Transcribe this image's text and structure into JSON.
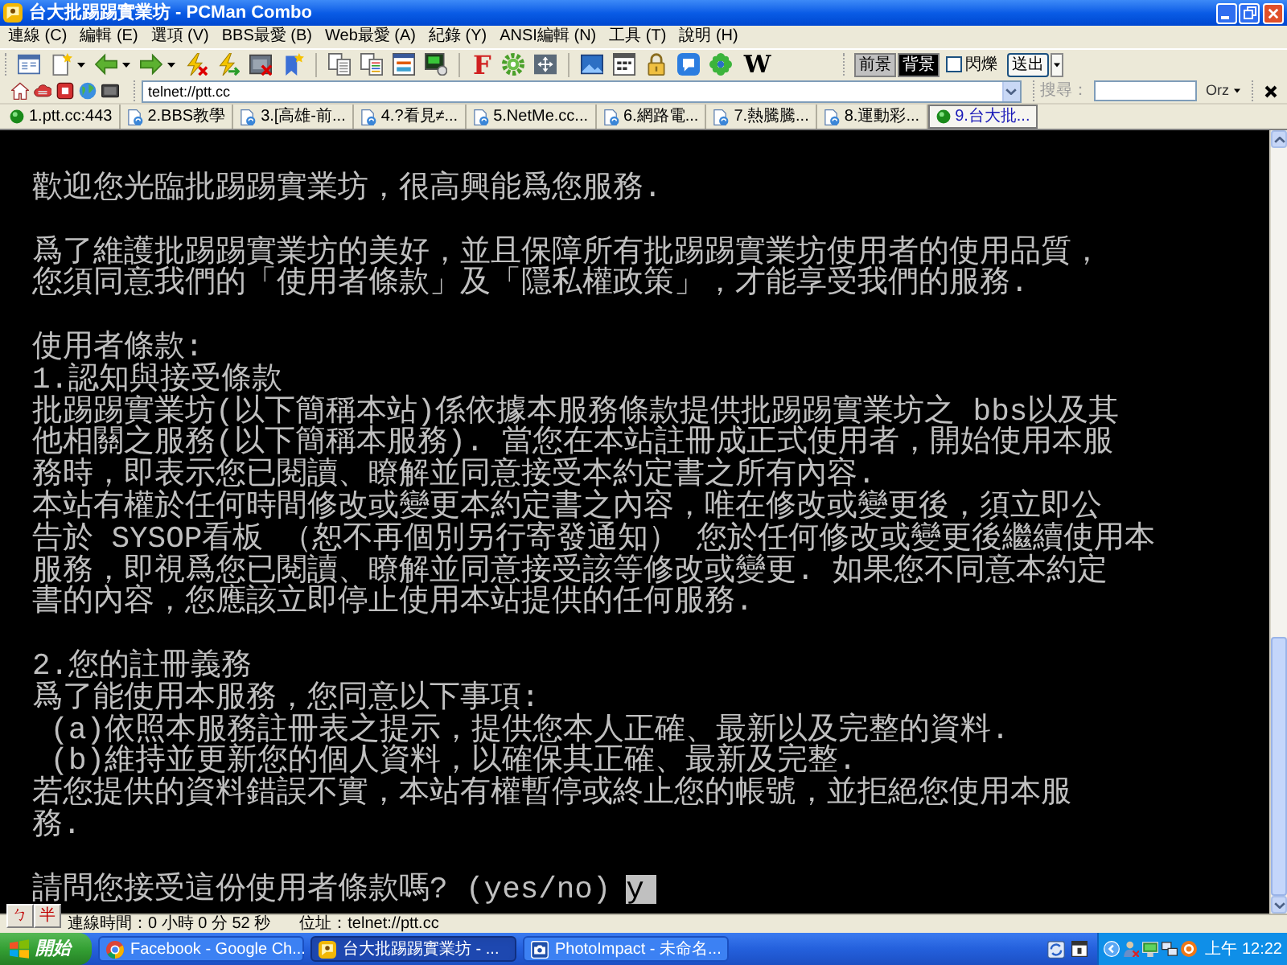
{
  "window": {
    "title": "台大批踢踢實業坊 - PCMan Combo"
  },
  "menu": [
    "連線 (C)",
    "編輯 (E)",
    "選項 (V)",
    "BBS最愛 (B)",
    "Web最愛 (A)",
    "紀錄 (Y)",
    "ANSI編輯 (N)",
    "工具 (T)",
    "說明 (H)"
  ],
  "toolbar": {
    "f_button": "F",
    "w_button": "W",
    "color_buttons": [
      {
        "label": "前景",
        "color": "#c0c0c0"
      },
      {
        "label": "背景",
        "color": "#000000"
      }
    ],
    "blink": {
      "label": "閃爍",
      "checked": false
    },
    "send_button": "送出"
  },
  "address_bar": {
    "value": "telnet://ptt.cc",
    "search_label": "搜尋：",
    "engine_button": "Orz"
  },
  "tabs": [
    {
      "label": "1.ptt.cc:443",
      "connected": true,
      "selected": false
    },
    {
      "label": "2.BBS教學",
      "connected": false,
      "selected": false
    },
    {
      "label": "3.[高雄-前...",
      "connected": false,
      "selected": false
    },
    {
      "label": "4.?看見≠...",
      "connected": false,
      "selected": false
    },
    {
      "label": "5.NetMe.cc...",
      "connected": false,
      "selected": false
    },
    {
      "label": "6.網路電...",
      "connected": false,
      "selected": false
    },
    {
      "label": "7.熱騰騰...",
      "connected": false,
      "selected": false
    },
    {
      "label": "8.運動彩...",
      "connected": false,
      "selected": false
    },
    {
      "label": "9.台大批...",
      "connected": true,
      "selected": true
    }
  ],
  "terminal": {
    "paragraphs": [
      [
        "歡迎您光臨批踢踢實業坊，很高興能爲您服務."
      ],
      [
        "爲了維護批踢踢實業坊的美好，並且保障所有批踢踢實業坊使用者的使用品質，",
        "您須同意我們的「使用者條款」及「隱私權政策」，才能享受我們的服務."
      ],
      [
        "使用者條款:",
        "1.認知與接受條款",
        "批踢踢實業坊(以下簡稱本站)係依據本服務條款提供批踢踢實業坊之 bbs以及其",
        "他相關之服務(以下簡稱本服務). 當您在本站註冊成正式使用者，開始使用本服",
        "務時，即表示您已閱讀、瞭解並同意接受本約定書之所有內容.",
        "本站有權於任何時間修改或變更本約定書之內容，唯在修改或變更後，須立即公",
        "告於 SYSOP看板 （恕不再個別另行寄發通知） 您於任何修改或變更後繼續使用本",
        "服務，即視爲您已閱讀、瞭解並同意接受該等修改或變更. 如果您不同意本約定",
        "書的內容，您應該立即停止使用本站提供的任何服務."
      ],
      [
        "2.您的註冊義務",
        "爲了能使用本服務，您同意以下事項:",
        " (a)依照本服務註冊表之提示，提供您本人正確、最新以及完整的資料.",
        " (b)維持並更新您的個人資料，以確保其正確、最新及完整.",
        "若您提供的資料錯誤不實，本站有權暫停或終止您的帳號，並拒絕您使用本服",
        "務."
      ]
    ],
    "prompt": "請問您接受這份使用者條款嗎? (yes/no)",
    "answer": "y"
  },
  "ime": {
    "input_mode": "ㄅ",
    "width_mode": "半"
  },
  "status_bar": {
    "connection_time": "連線時間：0 小時 0 分 52 秒",
    "address": "位址：telnet://ptt.cc"
  },
  "taskbar": {
    "start": "開始",
    "tasks": [
      {
        "label": "Facebook - Google Ch...",
        "kind": "browser",
        "selected": false
      },
      {
        "label": "台大批踢踢實業坊 - ...",
        "kind": "terminal",
        "selected": true
      },
      {
        "label": "PhotoImpact - 未命名...",
        "kind": "image_editor",
        "selected": false
      }
    ],
    "clock": "上午 12:22"
  }
}
